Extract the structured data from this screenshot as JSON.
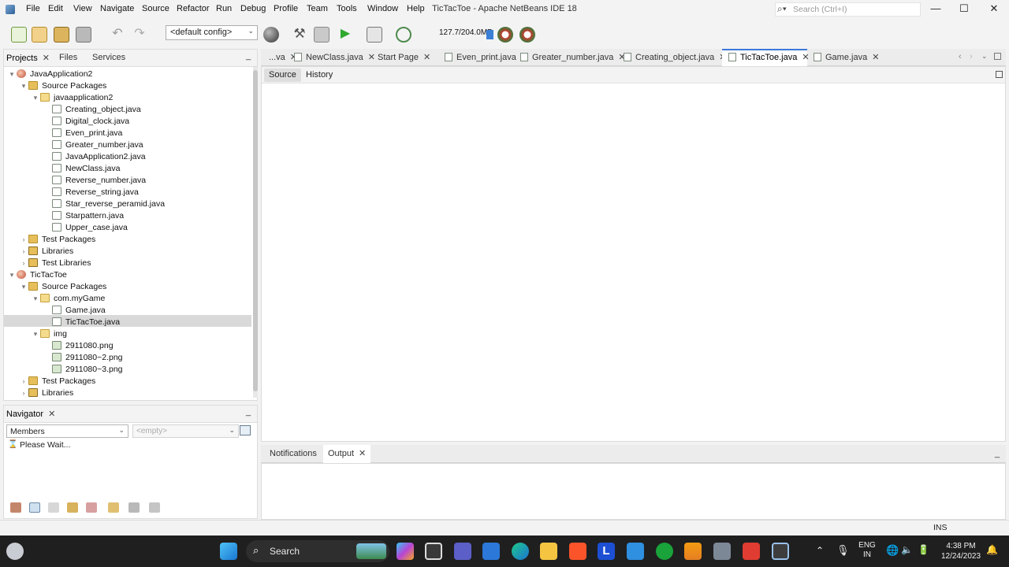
{
  "window": {
    "title": "TicTacToe - Apache NetBeans IDE 18",
    "search_placeholder": "Search (Ctrl+I)",
    "controls": {
      "minimize": "—",
      "maximize": "☐",
      "close": "✕"
    }
  },
  "menu": [
    "File",
    "Edit",
    "View",
    "Navigate",
    "Source",
    "Refactor",
    "Run",
    "Debug",
    "Profile",
    "Team",
    "Tools",
    "Window",
    "Help"
  ],
  "toolbar": {
    "config": "<default config>",
    "memory": "127.7/204.0MB",
    "icons": [
      "new-file-icon",
      "new-project-icon",
      "open-project-icon",
      "save-all-icon",
      "undo-icon",
      "redo-icon",
      "config-dropdown",
      "globe-icon",
      "build-icon",
      "clean-build-icon",
      "run-icon",
      "debug-icon",
      "profile-icon",
      "gc-icon",
      "profiler-icon"
    ]
  },
  "left_panel": {
    "tabs": [
      {
        "label": "Projects",
        "active": true,
        "closable": true
      },
      {
        "label": "Files",
        "active": false,
        "closable": false
      },
      {
        "label": "Services",
        "active": false,
        "closable": false
      }
    ],
    "tree": [
      {
        "label": "JavaApplication2",
        "type": "proj",
        "level": 0,
        "tw": "▾"
      },
      {
        "label": "Source Packages",
        "type": "pkgf",
        "level": 1,
        "tw": "▾"
      },
      {
        "label": "javaapplication2",
        "type": "pkg",
        "level": 2,
        "tw": "▾"
      },
      {
        "label": "Creating_object.java",
        "type": "java",
        "level": 3,
        "tw": ""
      },
      {
        "label": "Digital_clock.java",
        "type": "java",
        "level": 3,
        "tw": ""
      },
      {
        "label": "Even_print.java",
        "type": "java",
        "level": 3,
        "tw": ""
      },
      {
        "label": "Greater_number.java",
        "type": "java",
        "level": 3,
        "tw": ""
      },
      {
        "label": "JavaApplication2.java",
        "type": "java",
        "level": 3,
        "tw": ""
      },
      {
        "label": "NewClass.java",
        "type": "java",
        "level": 3,
        "tw": ""
      },
      {
        "label": "Reverse_number.java",
        "type": "java",
        "level": 3,
        "tw": ""
      },
      {
        "label": "Reverse_string.java",
        "type": "java",
        "level": 3,
        "tw": ""
      },
      {
        "label": "Star_reverse_peramid.java",
        "type": "java",
        "level": 3,
        "tw": ""
      },
      {
        "label": "Starpattern.java",
        "type": "java",
        "level": 3,
        "tw": ""
      },
      {
        "label": "Upper_case.java",
        "type": "java",
        "level": 3,
        "tw": ""
      },
      {
        "label": "Test Packages",
        "type": "pkgf",
        "level": 1,
        "tw": "›"
      },
      {
        "label": "Libraries",
        "type": "lib",
        "level": 1,
        "tw": "›"
      },
      {
        "label": "Test Libraries",
        "type": "lib",
        "level": 1,
        "tw": "›"
      },
      {
        "label": "TicTacToe",
        "type": "proj",
        "level": 0,
        "tw": "▾"
      },
      {
        "label": "Source Packages",
        "type": "pkgf",
        "level": 1,
        "tw": "▾"
      },
      {
        "label": "com.myGame",
        "type": "pkg",
        "level": 2,
        "tw": "▾"
      },
      {
        "label": "Game.java",
        "type": "java",
        "level": 3,
        "tw": ""
      },
      {
        "label": "TicTacToe.java",
        "type": "java",
        "level": 3,
        "tw": "",
        "selected": true
      },
      {
        "label": "img",
        "type": "pkg",
        "level": 2,
        "tw": "▾"
      },
      {
        "label": "2911080.png",
        "type": "png",
        "level": 3,
        "tw": ""
      },
      {
        "label": "2911080~2.png",
        "type": "png",
        "level": 3,
        "tw": ""
      },
      {
        "label": "2911080~3.png",
        "type": "png",
        "level": 3,
        "tw": ""
      },
      {
        "label": "Test Packages",
        "type": "pkgf",
        "level": 1,
        "tw": "›"
      },
      {
        "label": "Libraries",
        "type": "lib",
        "level": 1,
        "tw": "›"
      }
    ]
  },
  "navigator": {
    "title": "Navigator",
    "members": "Members",
    "empty": "<empty>",
    "status": "Please Wait..."
  },
  "editor": {
    "tabs": [
      {
        "label": "...va",
        "active": false,
        "closable": true
      },
      {
        "label": "NewClass.java",
        "active": false,
        "closable": true
      },
      {
        "label": "Start Page",
        "active": false,
        "closable": true
      },
      {
        "label": "Even_print.java",
        "active": false,
        "closable": true
      },
      {
        "label": "Greater_number.java",
        "active": false,
        "closable": true
      },
      {
        "label": "Creating_object.java",
        "active": false,
        "closable": true
      },
      {
        "label": "TicTacToe.java",
        "active": true,
        "closable": true
      },
      {
        "label": "Game.java",
        "active": false,
        "closable": true
      }
    ],
    "modes": {
      "source": "Source",
      "history": "History"
    }
  },
  "output": {
    "tabs": [
      {
        "label": "Notifications",
        "active": false
      },
      {
        "label": "Output",
        "active": true
      }
    ]
  },
  "status": {
    "mode": "INS"
  },
  "taskbar": {
    "search": "Search",
    "lang": "ENG",
    "region": "IN",
    "time": "4:38 PM",
    "date": "12/24/2023",
    "apps": [
      "windows-start-icon",
      "weather-icon",
      "search",
      "landscape-icon",
      "copilot-icon",
      "task-view-icon",
      "teams-icon",
      "store-icon",
      "edge-icon",
      "file-explorer-icon",
      "brave-icon",
      "l-app-icon",
      "vscode-icon",
      "xbox-icon",
      "vlc-icon",
      "snip-icon",
      "camera-icon",
      "netbeans-icon"
    ]
  }
}
